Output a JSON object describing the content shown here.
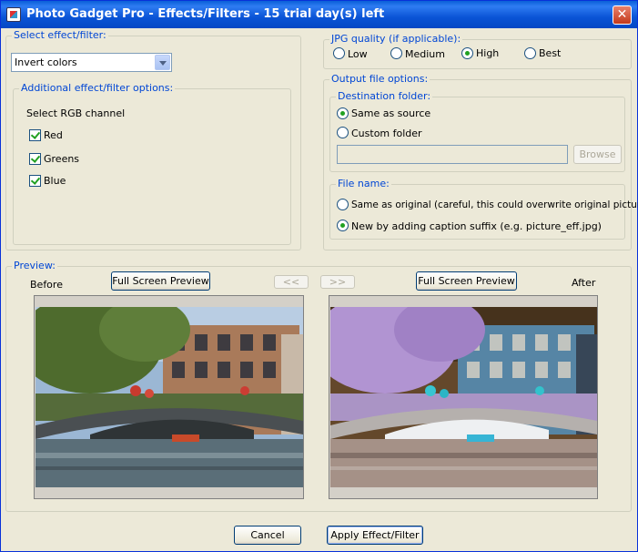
{
  "window": {
    "title": "Photo Gadget Pro - Effects/Filters - 15 trial day(s) left",
    "close_glyph": "✕"
  },
  "effect": {
    "legend": "Select effect/filter:",
    "selected": "Invert colors"
  },
  "additional": {
    "legend": "Additional effect/filter options:",
    "channel_label": "Select RGB channel",
    "channels": [
      {
        "label": "Red",
        "checked": true
      },
      {
        "label": "Greens",
        "checked": true
      },
      {
        "label": "Blue",
        "checked": true
      }
    ]
  },
  "jpg": {
    "legend": "JPG quality (if applicable):",
    "options": [
      {
        "label": "Low",
        "selected": false
      },
      {
        "label": "Medium",
        "selected": false
      },
      {
        "label": "High",
        "selected": true
      },
      {
        "label": "Best",
        "selected": false
      }
    ]
  },
  "output": {
    "legend": "Output file options:",
    "destination": {
      "legend": "Destination folder:",
      "same_as_source": "Same as source",
      "custom_folder": "Custom folder",
      "selected": "same_as_source",
      "path_value": "",
      "browse_label": "Browse"
    },
    "filename": {
      "legend": "File name:",
      "same_as_original": "Same as original (careful, this could overwrite original picture!",
      "new_suffix": "New by adding caption suffix (e.g. picture_eff.jpg)",
      "selected": "new_suffix"
    }
  },
  "preview": {
    "legend": "Preview:",
    "before_label": "Before",
    "after_label": "After",
    "full_screen_label": "Full Screen Preview",
    "prev_label": "<<",
    "next_label": ">>"
  },
  "footer": {
    "cancel_label": "Cancel",
    "apply_label": "Apply Effect/Filter"
  },
  "colors": {
    "title_bar": "#0a54d6",
    "group_label": "#0046d5",
    "dialog_bg": "#ece9d8"
  }
}
